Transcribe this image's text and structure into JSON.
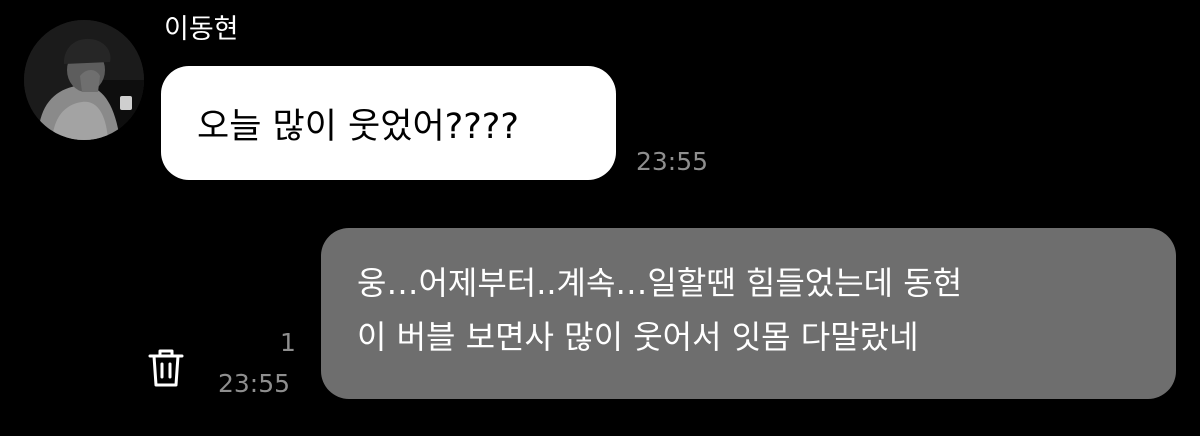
{
  "colors": {
    "background": "#000000",
    "incoming_bubble": "#ffffff",
    "outgoing_bubble": "#6e6e6e",
    "timestamp": "#8e8e8e"
  },
  "sender": {
    "name": "이동현",
    "avatar_icon": "profile-photo"
  },
  "incoming_message": {
    "text": "오늘 많이 웃었어????",
    "time": "23:55"
  },
  "outgoing_message": {
    "line1": "웅…어제부터..계속…일할땐 힘들었는데 동현",
    "line2": "이 버블 보면사 많이 웃어서 잇몸 다말랐네",
    "read_count": "1",
    "time": "23:55",
    "action_icon": "trash-icon"
  }
}
